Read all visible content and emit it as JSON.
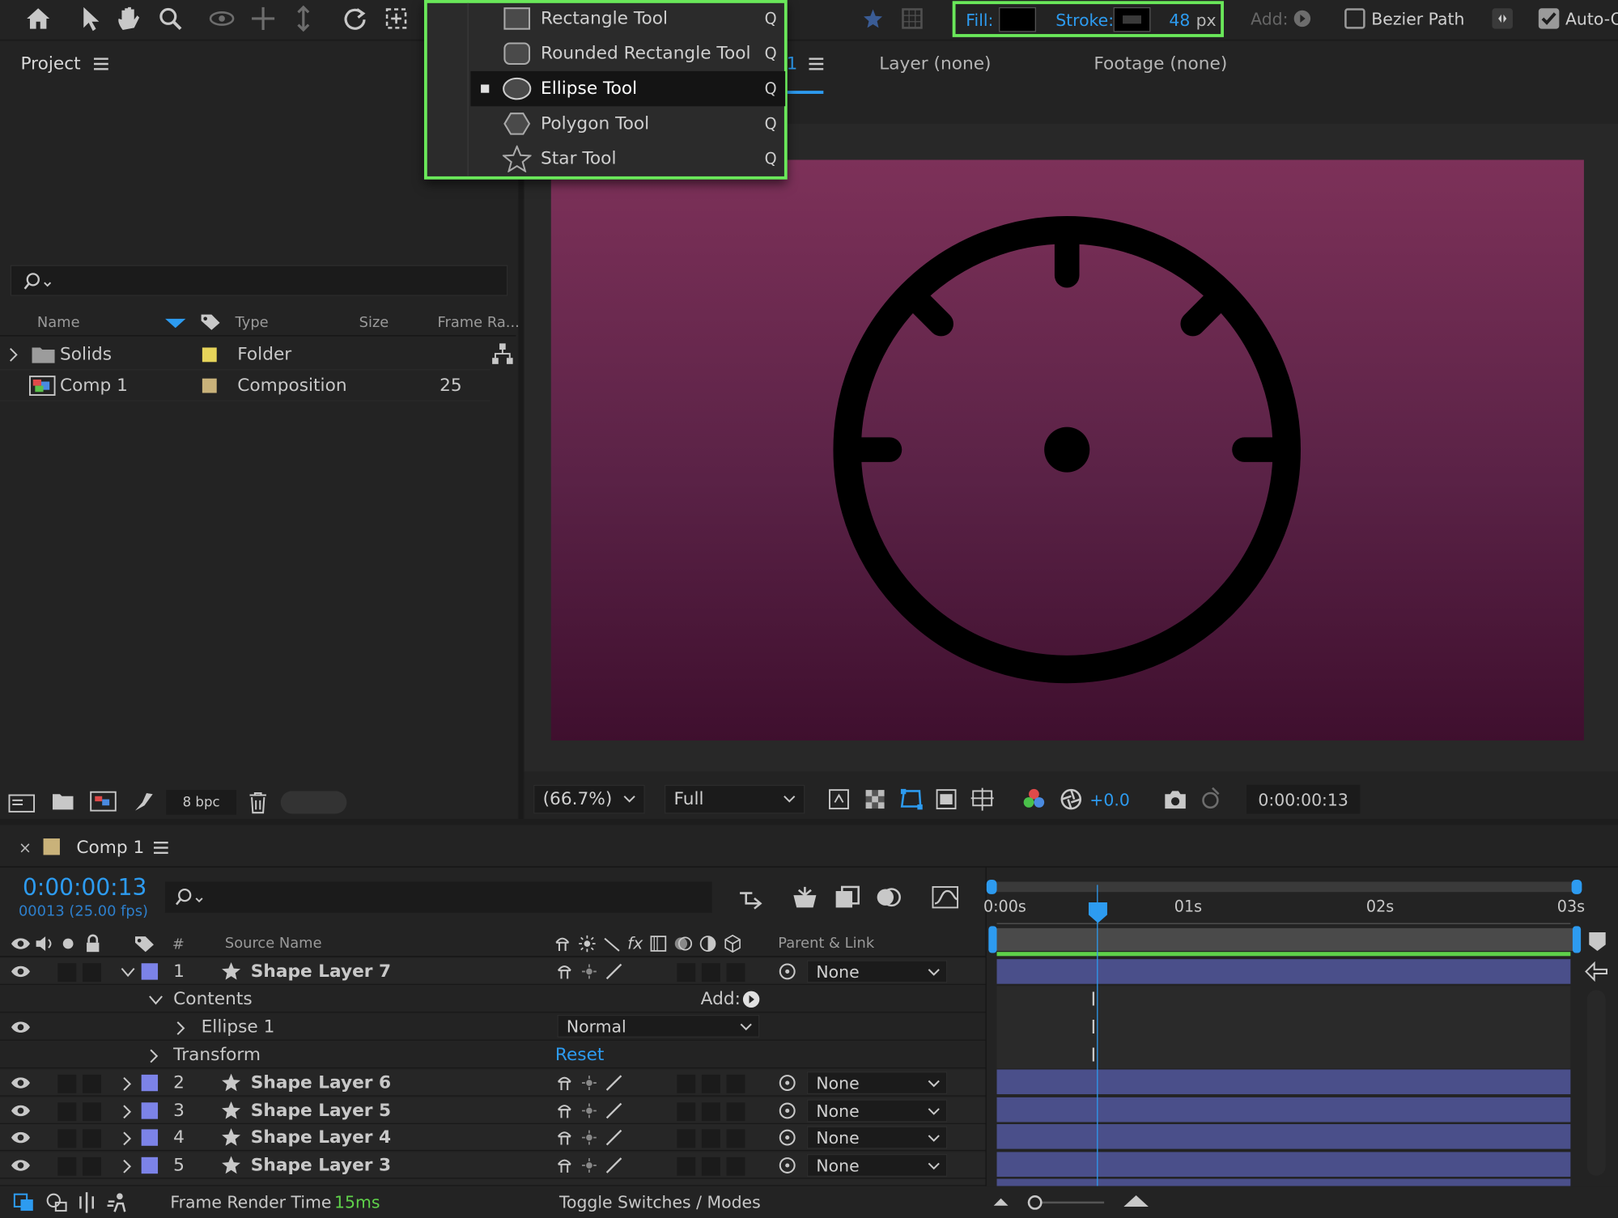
{
  "toolbar": {
    "fill_label": "Fill:",
    "stroke_label": "Stroke:",
    "stroke_width": "48",
    "stroke_unit": "px",
    "add_label": "Add:",
    "bezier_label": "Bezier Path",
    "auto_label": "Auto-O",
    "fill_color": "#000000",
    "stroke_color": "#222222"
  },
  "shape_menu": {
    "items": [
      {
        "label": "Rectangle Tool",
        "key": "Q"
      },
      {
        "label": "Rounded Rectangle Tool",
        "key": "Q"
      },
      {
        "label": "Ellipse Tool",
        "key": "Q",
        "selected": true
      },
      {
        "label": "Polygon Tool",
        "key": "Q"
      },
      {
        "label": "Star Tool",
        "key": "Q"
      }
    ]
  },
  "project": {
    "title": "Project",
    "columns": {
      "name": "Name",
      "type": "Type",
      "size": "Size",
      "frame_rate": "Frame Ra..."
    },
    "items": [
      {
        "name": "Solids",
        "type": "Folder",
        "frame_rate": "",
        "label_color": "#e6d45a"
      },
      {
        "name": "Comp 1",
        "type": "Composition",
        "frame_rate": "25",
        "label_color": "#c9b27a"
      }
    ],
    "bpc": "8 bpc"
  },
  "viewer": {
    "tab_comp_suffix": "1",
    "tab_layer": "Layer (none)",
    "tab_footage": "Footage (none)",
    "zoom": "(66.7%)",
    "resolution": "Full",
    "exposure": "+0.0",
    "timecode": "0:00:00:13"
  },
  "timeline": {
    "tab_title": "Comp 1",
    "timecode": "0:00:00:13",
    "frames": "00013 (25.00 fps)",
    "col_number": "#",
    "col_source": "Source Name",
    "col_parent": "Parent & Link",
    "ruler": [
      "0:00s",
      "01s",
      "02s",
      "03s"
    ],
    "contents_label": "Contents",
    "add_label": "Add:",
    "ellipse_label": "Ellipse 1",
    "blend_mode": "Normal",
    "transform_label": "Transform",
    "reset_label": "Reset",
    "layers": [
      {
        "num": "1",
        "name": "Shape Layer 7",
        "parent": "None"
      },
      {
        "num": "2",
        "name": "Shape Layer 6",
        "parent": "None"
      },
      {
        "num": "3",
        "name": "Shape Layer 5",
        "parent": "None"
      },
      {
        "num": "4",
        "name": "Shape Layer 4",
        "parent": "None"
      },
      {
        "num": "5",
        "name": "Shape Layer 3",
        "parent": "None"
      }
    ]
  },
  "status": {
    "render_label": "Frame Render Time",
    "render_value": "15ms",
    "toggle_label": "Toggle Switches / Modes"
  },
  "colors": {
    "accent": "#2d9bf0",
    "highlight": "#6ae85a",
    "layer_label": "#7c83e8",
    "canvas_top": "#7d3159",
    "canvas_bottom": "#3f0f2e"
  }
}
